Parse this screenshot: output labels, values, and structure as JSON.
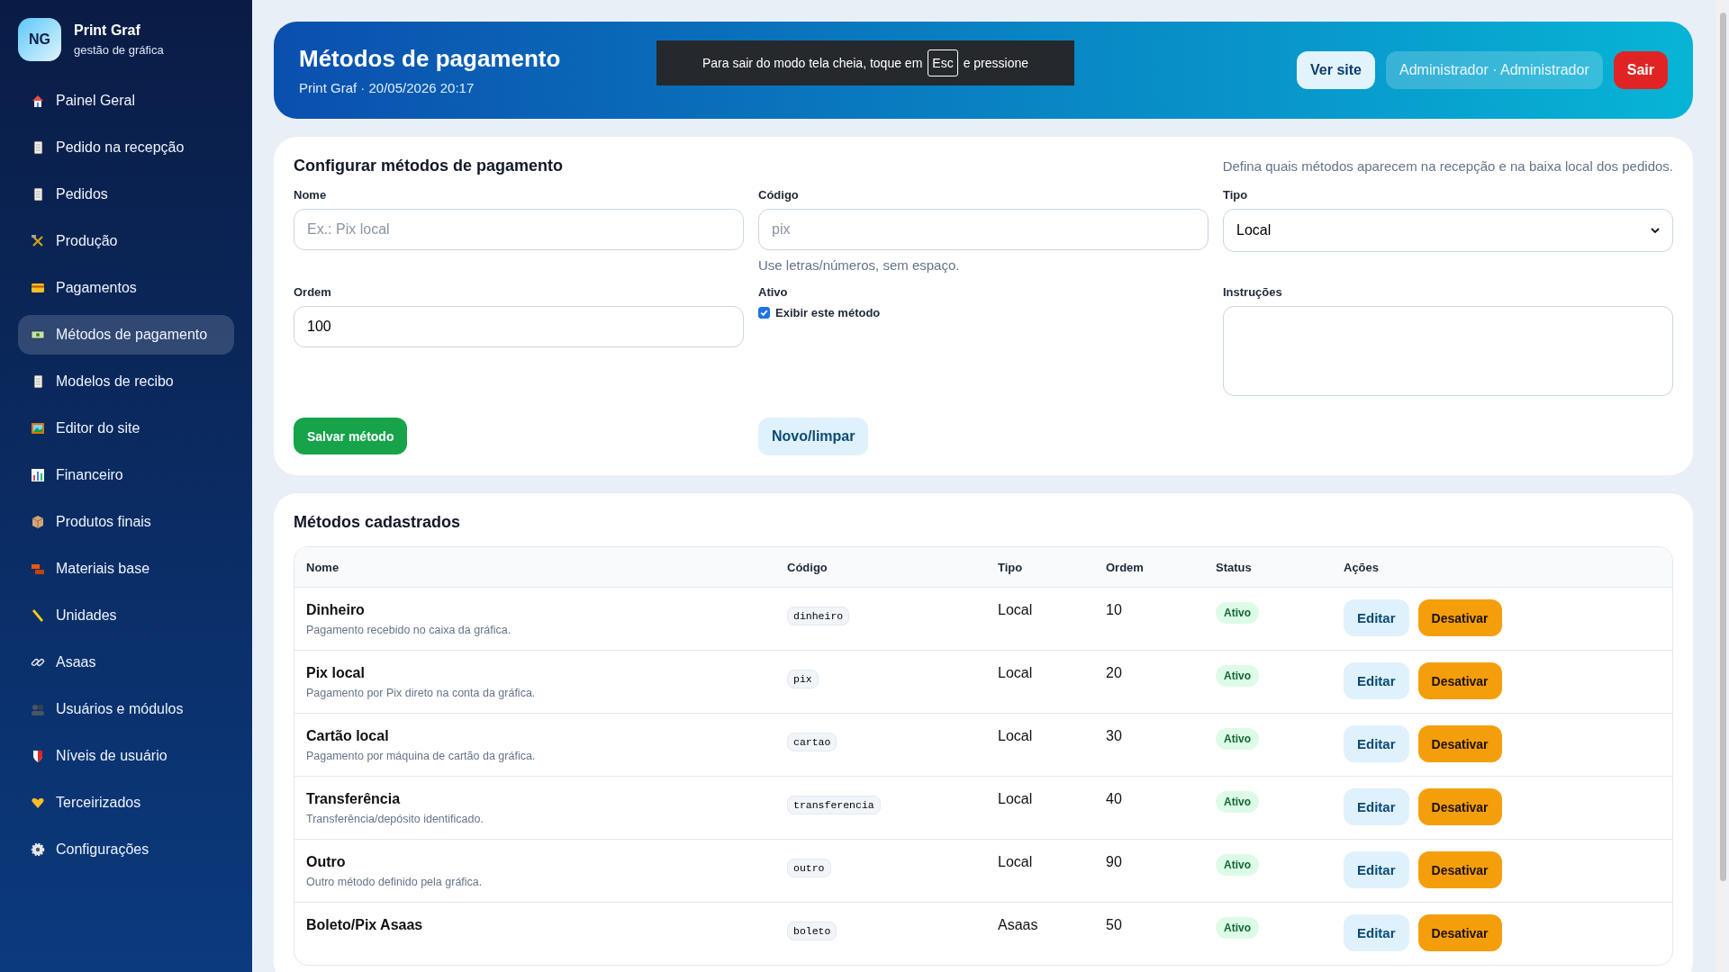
{
  "sidebar": {
    "brand": {
      "initials": "NG",
      "name": "Print Graf",
      "tagline": "gestão de gráfica"
    },
    "items": [
      {
        "label": "Painel Geral",
        "selected": false
      },
      {
        "label": "Pedido na recepção",
        "selected": false
      },
      {
        "label": "Pedidos",
        "selected": false
      },
      {
        "label": "Produção",
        "selected": false
      },
      {
        "label": "Pagamentos",
        "selected": false
      },
      {
        "label": "Métodos de pagamento",
        "selected": true
      },
      {
        "label": "Modelos de recibo",
        "selected": false
      },
      {
        "label": "Editor do site",
        "selected": false
      },
      {
        "label": "Financeiro",
        "selected": false
      },
      {
        "label": "Produtos finais",
        "selected": false
      },
      {
        "label": "Materiais base",
        "selected": false
      },
      {
        "label": "Unidades",
        "selected": false
      },
      {
        "label": "Asaas",
        "selected": false
      },
      {
        "label": "Usuários e módulos",
        "selected": false
      },
      {
        "label": "Níveis de usuário",
        "selected": false
      },
      {
        "label": "Terceirizados",
        "selected": false
      },
      {
        "label": "Configurações",
        "selected": false
      }
    ]
  },
  "header": {
    "title": "Métodos de pagamento",
    "subtitle": "Print Graf · 20/05/2026 20:17",
    "buttons": [
      {
        "label": "Ver site",
        "kind": "light"
      },
      {
        "label": "Administrador · Administrador",
        "kind": "ghost"
      },
      {
        "label": "Sair",
        "kind": "danger"
      }
    ]
  },
  "toast": {
    "before": "Para sair do modo tela cheia, toque em",
    "key": "Esc",
    "after": "e pressione"
  },
  "form": {
    "title": "Configurar métodos de pagamento",
    "hint": "Defina quais métodos aparecem na recepção e na baixa local dos pedidos.",
    "fields": [
      {
        "kind": "text",
        "label": "Nome",
        "placeholder": "Ex.: Pix local"
      },
      {
        "kind": "text",
        "label": "Código",
        "placeholder": "pix",
        "help": "Use letras/números, sem espaço."
      },
      {
        "kind": "select",
        "label": "Tipo",
        "value": "Local"
      },
      {
        "kind": "text",
        "label": "Ordem",
        "value": "100"
      },
      {
        "kind": "checkbox",
        "label": "Ativo",
        "option": "Exibir este método",
        "checked": true
      },
      {
        "kind": "textarea",
        "label": "Instruções"
      }
    ],
    "buttons": [
      {
        "label": "Salvar método",
        "kind": "primary"
      },
      {
        "label": "Novo/limpar",
        "kind": "secondary"
      }
    ]
  },
  "table": {
    "title": "Métodos cadastrados",
    "columns": [
      "Nome",
      "Código",
      "Tipo",
      "Ordem",
      "Status",
      "Ações"
    ],
    "rows": [
      {
        "name": "Dinheiro",
        "description": "Pagamento recebido no caixa da gráfica.",
        "code": "dinheiro",
        "type": "Local",
        "order": "10",
        "status": "Ativo",
        "actions": [
          "Editar",
          "Desativar"
        ]
      },
      {
        "name": "Pix local",
        "description": "Pagamento por Pix direto na conta da gráfica.",
        "code": "pix",
        "type": "Local",
        "order": "20",
        "status": "Ativo",
        "actions": [
          "Editar",
          "Desativar"
        ]
      },
      {
        "name": "Cartão local",
        "description": "Pagamento por máquina de cartão da gráfica.",
        "code": "cartao",
        "type": "Local",
        "order": "30",
        "status": "Ativo",
        "actions": [
          "Editar",
          "Desativar"
        ]
      },
      {
        "name": "Transferência",
        "description": "Transferência/depósito identificado.",
        "code": "transferencia",
        "type": "Local",
        "order": "40",
        "status": "Ativo",
        "actions": [
          "Editar",
          "Desativar"
        ]
      },
      {
        "name": "Outro",
        "description": "Outro método definido pela gráfica.",
        "code": "outro",
        "type": "Local",
        "order": "90",
        "status": "Ativo",
        "actions": [
          "Editar",
          "Desativar"
        ]
      },
      {
        "name": "Boleto/Pix Asaas",
        "code": "boleto",
        "type": "Asaas",
        "order": "50",
        "status": "Ativo",
        "actions": [
          "Editar",
          "Desativar"
        ]
      }
    ]
  }
}
